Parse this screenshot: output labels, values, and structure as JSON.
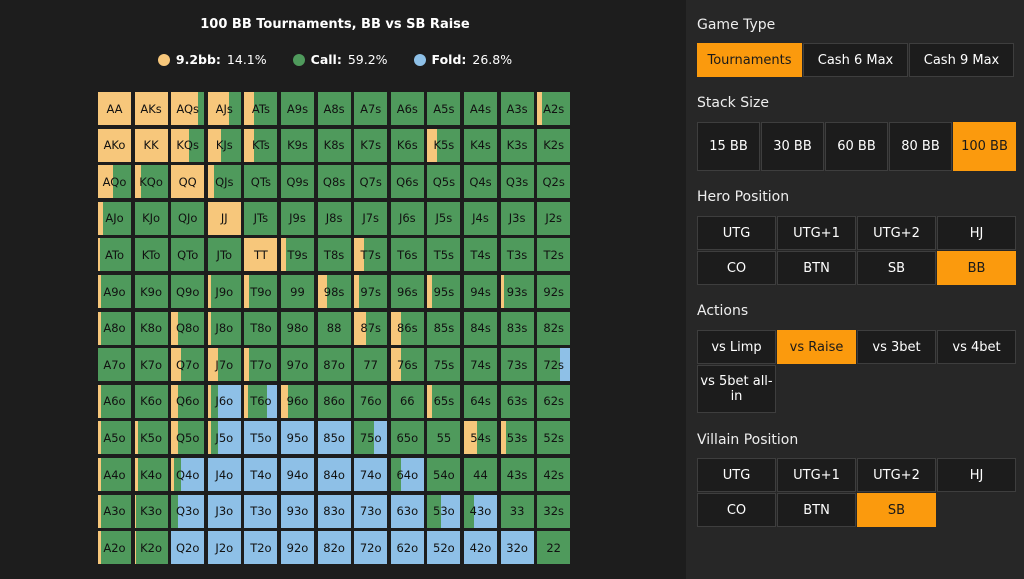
{
  "chart": {
    "title": "100 BB Tournaments, BB vs SB Raise",
    "legend": [
      {
        "name": "9.2bb:",
        "value": "14.1%",
        "color": "#f7c77b"
      },
      {
        "name": "Call:",
        "value": "59.2%",
        "color": "#4f9a5c"
      },
      {
        "name": "Fold:",
        "value": "26.8%",
        "color": "#8ec0e7"
      }
    ]
  },
  "colors": {
    "raise": "#f7c77b",
    "call": "#4f9a5c",
    "fold": "#8ec0e7",
    "active": "#fb9a0d"
  },
  "hands": [
    [
      "AA",
      "AKs",
      "AQs",
      "AJs",
      "ATs",
      "A9s",
      "A8s",
      "A7s",
      "A6s",
      "A5s",
      "A4s",
      "A3s",
      "A2s"
    ],
    [
      "AKo",
      "KK",
      "KQs",
      "KJs",
      "KTs",
      "K9s",
      "K8s",
      "K7s",
      "K6s",
      "K5s",
      "K4s",
      "K3s",
      "K2s"
    ],
    [
      "AQo",
      "KQo",
      "QQ",
      "QJs",
      "QTs",
      "Q9s",
      "Q8s",
      "Q7s",
      "Q6s",
      "Q5s",
      "Q4s",
      "Q3s",
      "Q2s"
    ],
    [
      "AJo",
      "KJo",
      "QJo",
      "JJ",
      "JTs",
      "J9s",
      "J8s",
      "J7s",
      "J6s",
      "J5s",
      "J4s",
      "J3s",
      "J2s"
    ],
    [
      "ATo",
      "KTo",
      "QTo",
      "JTo",
      "TT",
      "T9s",
      "T8s",
      "T7s",
      "T6s",
      "T5s",
      "T4s",
      "T3s",
      "T2s"
    ],
    [
      "A9o",
      "K9o",
      "Q9o",
      "J9o",
      "T9o",
      "99",
      "98s",
      "97s",
      "96s",
      "95s",
      "94s",
      "93s",
      "92s"
    ],
    [
      "A8o",
      "K8o",
      "Q8o",
      "J8o",
      "T8o",
      "98o",
      "88",
      "87s",
      "86s",
      "85s",
      "84s",
      "83s",
      "82s"
    ],
    [
      "A7o",
      "K7o",
      "Q7o",
      "J7o",
      "T7o",
      "97o",
      "87o",
      "77",
      "76s",
      "75s",
      "74s",
      "73s",
      "72s"
    ],
    [
      "A6o",
      "K6o",
      "Q6o",
      "J6o",
      "T6o",
      "96o",
      "86o",
      "76o",
      "66",
      "65s",
      "64s",
      "63s",
      "62s"
    ],
    [
      "A5o",
      "K5o",
      "Q5o",
      "J5o",
      "T5o",
      "95o",
      "85o",
      "75o",
      "65o",
      "55",
      "54s",
      "53s",
      "52s"
    ],
    [
      "A4o",
      "K4o",
      "Q4o",
      "J4o",
      "T4o",
      "94o",
      "84o",
      "74o",
      "64o",
      "54o",
      "44",
      "43s",
      "42s"
    ],
    [
      "A3o",
      "K3o",
      "Q3o",
      "J3o",
      "T3o",
      "93o",
      "83o",
      "73o",
      "63o",
      "53o",
      "43o",
      "33",
      "32s"
    ],
    [
      "A2o",
      "K2o",
      "Q2o",
      "J2o",
      "T2o",
      "92o",
      "82o",
      "72o",
      "62o",
      "52o",
      "42o",
      "32o",
      "22"
    ]
  ],
  "frequencies": [
    [
      [
        1,
        0,
        0
      ],
      [
        1,
        0,
        0
      ],
      [
        0.8,
        0.2,
        0
      ],
      [
        0.65,
        0.35,
        0
      ],
      [
        0.3,
        0.7,
        0
      ],
      [
        0,
        1,
        0
      ],
      [
        0,
        1,
        0
      ],
      [
        0,
        1,
        0
      ],
      [
        0,
        1,
        0
      ],
      [
        0,
        1,
        0
      ],
      [
        0,
        1,
        0
      ],
      [
        0,
        1,
        0
      ],
      [
        0.15,
        0.85,
        0
      ]
    ],
    [
      [
        1,
        0,
        0
      ],
      [
        1,
        0,
        0
      ],
      [
        0.55,
        0.45,
        0
      ],
      [
        0.4,
        0.6,
        0
      ],
      [
        0.3,
        0.7,
        0
      ],
      [
        0,
        1,
        0
      ],
      [
        0,
        1,
        0
      ],
      [
        0,
        1,
        0
      ],
      [
        0,
        1,
        0
      ],
      [
        0.3,
        0.7,
        0
      ],
      [
        0,
        1,
        0
      ],
      [
        0,
        1,
        0
      ],
      [
        0,
        1,
        0
      ]
    ],
    [
      [
        0.45,
        0.55,
        0
      ],
      [
        0.2,
        0.8,
        0
      ],
      [
        1,
        0,
        0
      ],
      [
        0.2,
        0.8,
        0
      ],
      [
        0,
        1,
        0
      ],
      [
        0,
        1,
        0
      ],
      [
        0,
        1,
        0
      ],
      [
        0,
        1,
        0
      ],
      [
        0,
        1,
        0
      ],
      [
        0,
        1,
        0
      ],
      [
        0,
        1,
        0
      ],
      [
        0,
        1,
        0
      ],
      [
        0,
        1,
        0
      ]
    ],
    [
      [
        0.15,
        0.85,
        0
      ],
      [
        0,
        1,
        0
      ],
      [
        0,
        1,
        0
      ],
      [
        1,
        0,
        0
      ],
      [
        0,
        1,
        0
      ],
      [
        0,
        1,
        0
      ],
      [
        0,
        1,
        0
      ],
      [
        0,
        1,
        0
      ],
      [
        0,
        1,
        0
      ],
      [
        0,
        1,
        0
      ],
      [
        0,
        1,
        0
      ],
      [
        0,
        1,
        0
      ],
      [
        0,
        1,
        0
      ]
    ],
    [
      [
        0.05,
        0.95,
        0
      ],
      [
        0,
        1,
        0
      ],
      [
        0,
        1,
        0
      ],
      [
        0,
        1,
        0
      ],
      [
        1,
        0,
        0
      ],
      [
        0.15,
        0.85,
        0
      ],
      [
        0,
        1,
        0
      ],
      [
        0.3,
        0.7,
        0
      ],
      [
        0,
        1,
        0
      ],
      [
        0,
        1,
        0
      ],
      [
        0,
        1,
        0
      ],
      [
        0,
        1,
        0
      ],
      [
        0,
        1,
        0
      ]
    ],
    [
      [
        0.1,
        0.9,
        0
      ],
      [
        0,
        1,
        0
      ],
      [
        0,
        1,
        0
      ],
      [
        0.1,
        0.9,
        0
      ],
      [
        0.15,
        0.85,
        0
      ],
      [
        0,
        1,
        0
      ],
      [
        0.3,
        0.7,
        0
      ],
      [
        0.15,
        0.85,
        0
      ],
      [
        0,
        1,
        0
      ],
      [
        0.15,
        0.85,
        0
      ],
      [
        0,
        1,
        0
      ],
      [
        0.1,
        0.9,
        0
      ],
      [
        0,
        1,
        0
      ]
    ],
    [
      [
        0.1,
        0.9,
        0
      ],
      [
        0,
        1,
        0
      ],
      [
        0.2,
        0.8,
        0
      ],
      [
        0.1,
        0.9,
        0
      ],
      [
        0,
        1,
        0
      ],
      [
        0,
        1,
        0
      ],
      [
        0,
        1,
        0
      ],
      [
        0.35,
        0.65,
        0
      ],
      [
        0.3,
        0.7,
        0
      ],
      [
        0,
        1,
        0
      ],
      [
        0,
        1,
        0
      ],
      [
        0,
        1,
        0
      ],
      [
        0,
        1,
        0
      ]
    ],
    [
      [
        0,
        1,
        0
      ],
      [
        0,
        1,
        0
      ],
      [
        0.3,
        0.7,
        0
      ],
      [
        0.3,
        0.7,
        0
      ],
      [
        0.15,
        0.85,
        0
      ],
      [
        0,
        1,
        0
      ],
      [
        0,
        1,
        0
      ],
      [
        0,
        1,
        0
      ],
      [
        0.3,
        0.7,
        0
      ],
      [
        0,
        1,
        0
      ],
      [
        0,
        1,
        0
      ],
      [
        0,
        1,
        0
      ],
      [
        0,
        0.7,
        0.3
      ]
    ],
    [
      [
        0.1,
        0.9,
        0
      ],
      [
        0,
        1,
        0
      ],
      [
        0.2,
        0.8,
        0
      ],
      [
        0.1,
        0.2,
        0.7
      ],
      [
        0.1,
        0.6,
        0.3
      ],
      [
        0.2,
        0.8,
        0
      ],
      [
        0,
        1,
        0
      ],
      [
        0,
        1,
        0
      ],
      [
        0,
        1,
        0
      ],
      [
        0.15,
        0.85,
        0
      ],
      [
        0,
        1,
        0
      ],
      [
        0,
        1,
        0
      ],
      [
        0,
        1,
        0
      ]
    ],
    [
      [
        0.1,
        0.9,
        0
      ],
      [
        0.1,
        0.9,
        0
      ],
      [
        0.2,
        0.8,
        0
      ],
      [
        0.1,
        0.2,
        0.7
      ],
      [
        0,
        0,
        1
      ],
      [
        0,
        0,
        1
      ],
      [
        0,
        0,
        1
      ],
      [
        0,
        0.6,
        0.4
      ],
      [
        0,
        1,
        0
      ],
      [
        0,
        1,
        0
      ],
      [
        0.4,
        0.6,
        0
      ],
      [
        0.15,
        0.85,
        0
      ],
      [
        0,
        1,
        0
      ]
    ],
    [
      [
        0.1,
        0.9,
        0
      ],
      [
        0.1,
        0.9,
        0
      ],
      [
        0.1,
        0.2,
        0.7
      ],
      [
        0,
        0,
        1
      ],
      [
        0,
        0,
        1
      ],
      [
        0,
        0,
        1
      ],
      [
        0,
        0,
        1
      ],
      [
        0,
        0,
        1
      ],
      [
        0,
        0.3,
        0.7
      ],
      [
        0,
        1,
        0
      ],
      [
        0,
        1,
        0
      ],
      [
        0,
        1,
        0
      ],
      [
        0,
        1,
        0
      ]
    ],
    [
      [
        0.1,
        0.9,
        0
      ],
      [
        0.05,
        0.95,
        0
      ],
      [
        0,
        0.2,
        0.8
      ],
      [
        0,
        0,
        1
      ],
      [
        0,
        0,
        1
      ],
      [
        0,
        0,
        1
      ],
      [
        0,
        0,
        1
      ],
      [
        0,
        0,
        1
      ],
      [
        0,
        0,
        1
      ],
      [
        0,
        0.4,
        0.6
      ],
      [
        0,
        0.3,
        0.7
      ],
      [
        0,
        1,
        0
      ],
      [
        0,
        1,
        0
      ]
    ],
    [
      [
        0.1,
        0.9,
        0
      ],
      [
        0.05,
        0.95,
        0
      ],
      [
        0,
        0,
        1
      ],
      [
        0,
        0,
        1
      ],
      [
        0,
        0,
        1
      ],
      [
        0,
        0,
        1
      ],
      [
        0,
        0,
        1
      ],
      [
        0,
        0,
        1
      ],
      [
        0,
        0,
        1
      ],
      [
        0,
        0,
        1
      ],
      [
        0,
        0,
        1
      ],
      [
        0,
        0,
        1
      ],
      [
        0,
        1,
        0
      ]
    ]
  ],
  "panel": {
    "game_type": {
      "title": "Game Type",
      "buttons": [
        "Tournaments",
        "Cash 6 Max",
        "Cash 9 Max"
      ],
      "active": 0
    },
    "stack_size": {
      "title": "Stack Size",
      "buttons": [
        "15 BB",
        "30 BB",
        "60 BB",
        "80 BB",
        "100 BB"
      ],
      "active": 4
    },
    "hero_position": {
      "title": "Hero Position",
      "buttons": [
        "UTG",
        "UTG+1",
        "UTG+2",
        "HJ",
        "CO",
        "BTN",
        "SB",
        "BB"
      ],
      "active": 7
    },
    "actions": {
      "title": "Actions",
      "buttons": [
        "vs Limp",
        "vs Raise",
        "vs 3bet",
        "vs 4bet",
        "vs 5bet all-in"
      ],
      "active": 1
    },
    "villain_position": {
      "title": "Villain Position",
      "buttons": [
        "UTG",
        "UTG+1",
        "UTG+2",
        "HJ",
        "CO",
        "BTN",
        "SB"
      ],
      "active": 6
    }
  }
}
